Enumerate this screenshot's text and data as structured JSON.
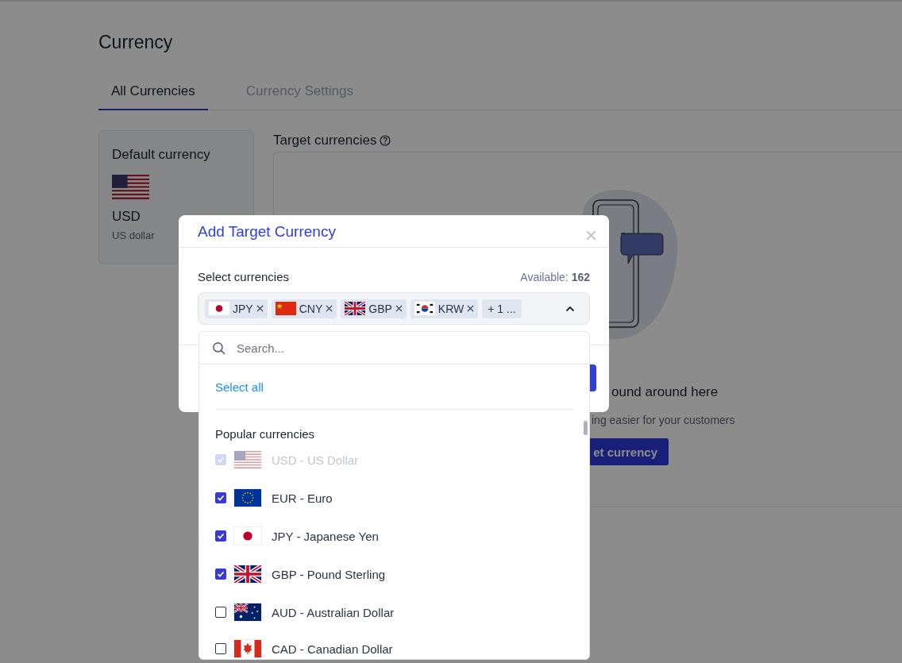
{
  "page": {
    "title": "Currency"
  },
  "tabs": [
    {
      "label": "All Currencies",
      "selected": true
    },
    {
      "label": "Currency Settings",
      "selected": false
    }
  ],
  "default_currency": {
    "heading": "Default currency",
    "kind": "usa",
    "code": "USD",
    "name": "US dollar"
  },
  "target_currencies": {
    "heading": "Target currencies",
    "empty_title": "ound around here",
    "empty_text": "ing easier for your customers",
    "button": "et currency"
  },
  "dialog": {
    "title": "Add Target Currency",
    "field_label": "Select currencies",
    "available_label": "Available:",
    "available_count": "162",
    "chips": [
      {
        "kind": "japan",
        "code": "JPY"
      },
      {
        "kind": "china",
        "code": "CNY"
      },
      {
        "kind": "uk",
        "code": "GBP"
      },
      {
        "kind": "korea",
        "code": "KRW"
      }
    ],
    "more_chip": "+ 1 ...",
    "dropdown": {
      "search_placeholder": "Search...",
      "select_all": "Select all",
      "group_title": "Popular currencies",
      "items": [
        {
          "kind": "usa",
          "label": "USD - US Dollar",
          "checked": true,
          "disabled": true
        },
        {
          "kind": "eu",
          "label": "EUR - Euro",
          "checked": true,
          "disabled": false
        },
        {
          "kind": "japan",
          "label": "JPY - Japanese Yen",
          "checked": true,
          "disabled": false
        },
        {
          "kind": "uk",
          "label": "GBP - Pound Sterling",
          "checked": true,
          "disabled": false
        },
        {
          "kind": "australia",
          "label": "AUD - Australian Dollar",
          "checked": false,
          "disabled": false
        },
        {
          "kind": "canada",
          "label": "CAD - Canadian Dollar",
          "checked": false,
          "disabled": false
        }
      ]
    }
  }
}
